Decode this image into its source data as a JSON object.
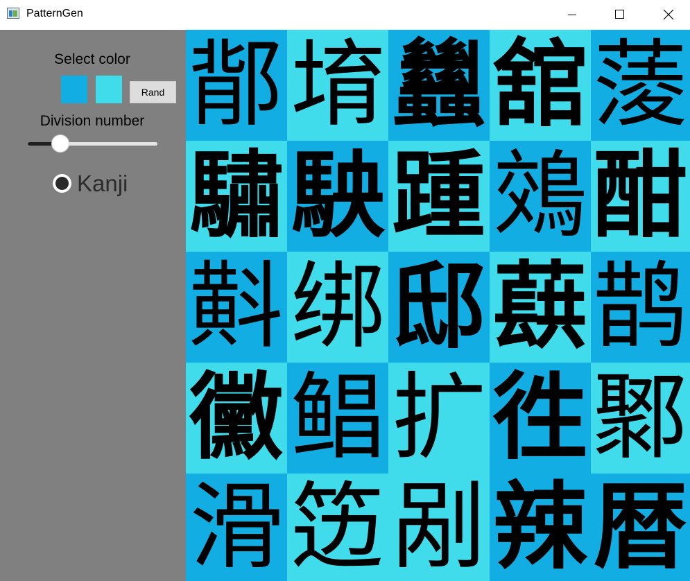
{
  "window": {
    "title": "PatternGen"
  },
  "sidebar": {
    "select_color_label": "Select color",
    "colors": [
      "#12ade3",
      "#41dceb"
    ],
    "rand_label": "Rand",
    "division_label": "Division number",
    "division_slider_fraction": 0.25,
    "mode_label": "Kanji"
  },
  "grid": {
    "colors": [
      "#12ade3",
      "#41dceb"
    ],
    "rows": [
      {
        "cells": [
          {
            "char": "鄁",
            "color": 0,
            "weight": "normal"
          },
          {
            "char": "堉",
            "color": 1,
            "weight": "normal"
          },
          {
            "char": "蠿",
            "color": 0,
            "weight": "bold"
          },
          {
            "char": "舘",
            "color": 1,
            "weight": "bold"
          },
          {
            "char": "蔆",
            "color": 0,
            "weight": "normal"
          }
        ]
      },
      {
        "cells": [
          {
            "char": "驌",
            "color": 1,
            "weight": "bold"
          },
          {
            "char": "駚",
            "color": 0,
            "weight": "bold"
          },
          {
            "char": "踵",
            "color": 1,
            "weight": "bold"
          },
          {
            "char": "鵁",
            "color": 0,
            "weight": "normal"
          },
          {
            "char": "酣",
            "color": 1,
            "weight": "bold"
          }
        ]
      },
      {
        "cells": [
          {
            "char": "斢",
            "color": 0,
            "weight": "normal"
          },
          {
            "char": "绑",
            "color": 1,
            "weight": "normal"
          },
          {
            "char": "邸",
            "color": 0,
            "weight": "bold"
          },
          {
            "char": "蕻",
            "color": 1,
            "weight": "bold"
          },
          {
            "char": "鹊",
            "color": 0,
            "weight": "normal"
          }
        ]
      },
      {
        "cells": [
          {
            "char": "黴",
            "color": 1,
            "weight": "bold"
          },
          {
            "char": "鲳",
            "color": 0,
            "weight": "normal"
          },
          {
            "char": "扩",
            "color": 1,
            "weight": "normal"
          },
          {
            "char": "徃",
            "color": 0,
            "weight": "bold"
          },
          {
            "char": "鄹",
            "color": 1,
            "weight": "normal"
          }
        ]
      },
      {
        "cells": [
          {
            "char": "滑",
            "color": 0,
            "weight": "normal"
          },
          {
            "char": "笾",
            "color": 1,
            "weight": "normal"
          },
          {
            "char": "剐",
            "color": 1,
            "weight": "normal"
          },
          {
            "char": "辣",
            "color": 0,
            "weight": "bold"
          },
          {
            "char": "暦",
            "color": 0,
            "weight": "bold"
          }
        ]
      }
    ]
  }
}
